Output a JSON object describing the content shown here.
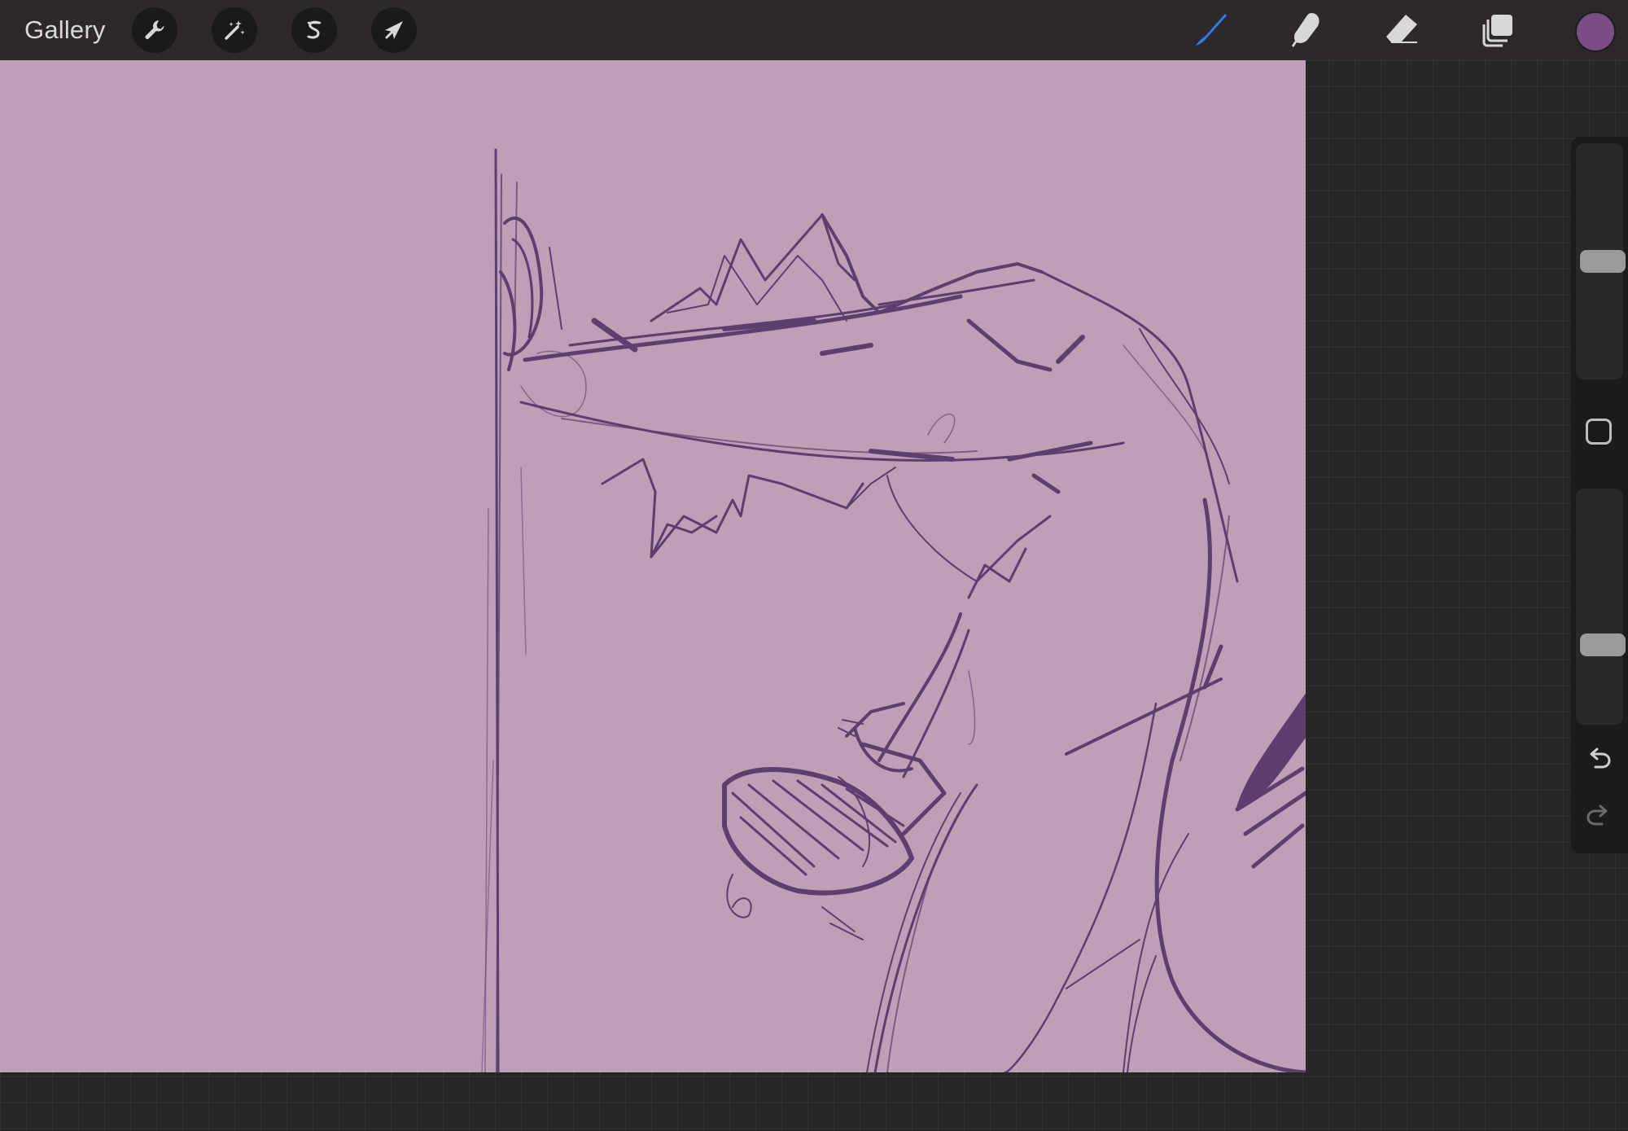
{
  "toolbar": {
    "gallery_label": "Gallery",
    "left_tools": [
      {
        "name": "actions",
        "icon": "wrench-icon"
      },
      {
        "name": "adjustments",
        "icon": "magic-wand-icon"
      },
      {
        "name": "selection",
        "icon": "selection-s-icon"
      },
      {
        "name": "transform",
        "icon": "arrow-cursor-icon"
      }
    ],
    "right_tools": [
      {
        "name": "brush",
        "icon": "brush-icon",
        "active": true,
        "color": "#2f7df6"
      },
      {
        "name": "smudge",
        "icon": "smudge-finger-icon",
        "active": false
      },
      {
        "name": "eraser",
        "icon": "eraser-icon",
        "active": false
      },
      {
        "name": "layers",
        "icon": "layers-icon",
        "active": false
      }
    ],
    "current_color": "#7a4d86"
  },
  "canvas": {
    "background_color": "#bf9fb6",
    "stroke_color": "#5e3e6e"
  },
  "sidebar": {
    "brush_size_level": 0.5,
    "brush_opacity_level": 0.32,
    "modifier_icon": "square-modifier-icon",
    "undo_icon": "undo-icon",
    "redo_icon": "redo-icon"
  }
}
